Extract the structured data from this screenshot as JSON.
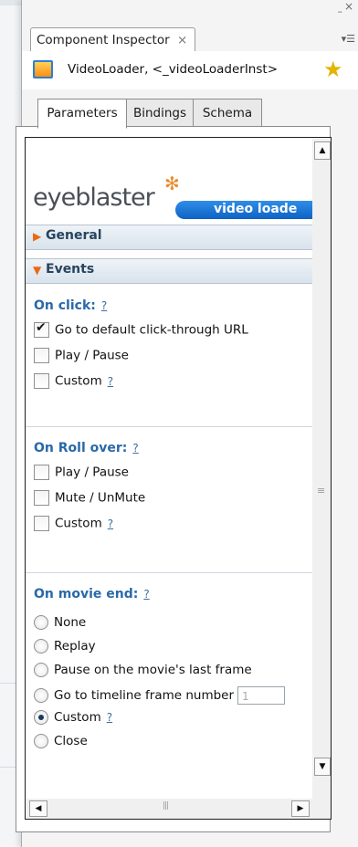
{
  "panel": {
    "tab_label": "Component Inspector",
    "tab_close": "×",
    "minimize": "–",
    "close": "×",
    "menu": "▾☰"
  },
  "component": {
    "name": "VideoLoader, <_videoLoaderInst>"
  },
  "param_tabs": [
    {
      "label": "Parameters",
      "active": true
    },
    {
      "label": "Bindings",
      "active": false
    },
    {
      "label": "Schema",
      "active": false
    }
  ],
  "banner": {
    "logo": "eyeblaster",
    "product": "video loade"
  },
  "sections": {
    "general": {
      "label": "General",
      "expanded": false
    },
    "events": {
      "label": "Events",
      "expanded": true
    }
  },
  "on_click": {
    "label": "On click:",
    "help": "?",
    "options": [
      {
        "label": "Go to default click-through URL",
        "checked": true
      },
      {
        "label": "Play / Pause",
        "checked": false
      },
      {
        "label": "Custom",
        "checked": false,
        "help": "?"
      }
    ]
  },
  "on_roll_over": {
    "label": "On Roll over:",
    "help": "?",
    "options": [
      {
        "label": "Play / Pause",
        "checked": false
      },
      {
        "label": "Mute / UnMute",
        "checked": false
      },
      {
        "label": "Custom",
        "checked": false,
        "help": "?"
      }
    ]
  },
  "on_movie_end": {
    "label": "On movie end:",
    "help": "?",
    "options": [
      {
        "label": "None",
        "selected": false
      },
      {
        "label": "Replay",
        "selected": false
      },
      {
        "label": "Pause on the movie's last frame",
        "selected": false
      },
      {
        "label": "Go to timeline frame number",
        "selected": false,
        "input_value": "1"
      },
      {
        "label": "Custom",
        "selected": true,
        "help": "?"
      },
      {
        "label": "Close",
        "selected": false
      }
    ]
  },
  "colors": {
    "accent": "#2a69a8",
    "banner_blue": "#1872d6",
    "arrow_orange": "#e86a16"
  }
}
